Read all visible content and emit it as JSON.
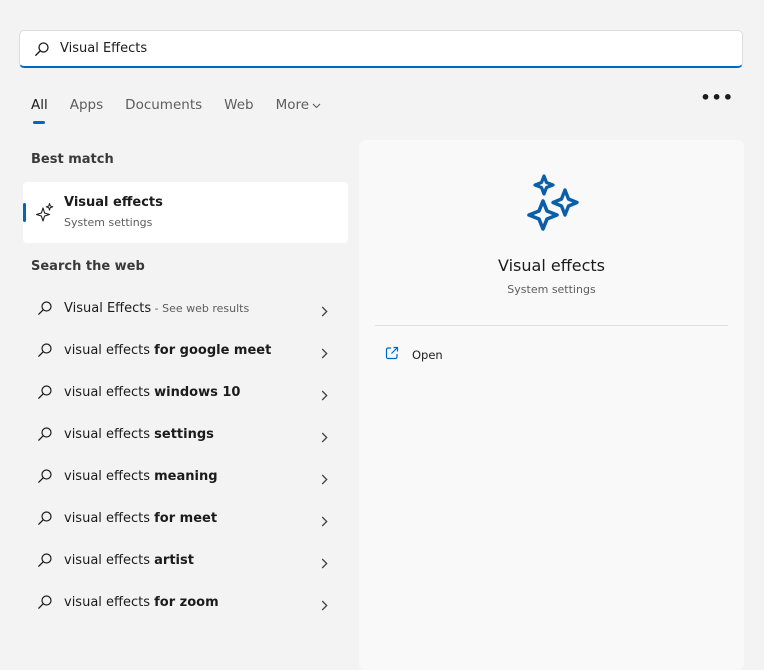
{
  "search": {
    "value": "Visual Effects",
    "icon": "search-icon"
  },
  "tabs": [
    {
      "label": "All",
      "active": true
    },
    {
      "label": "Apps"
    },
    {
      "label": "Documents"
    },
    {
      "label": "Web"
    },
    {
      "label": "More"
    }
  ],
  "more_options": "•••",
  "best_match": {
    "heading": "Best match",
    "title": "Visual effects",
    "subtitle": "System settings",
    "icon": "sparkle-icon"
  },
  "web": {
    "heading": "Search the web",
    "items": [
      {
        "prefix": "Visual Effects",
        "bold": "",
        "hint": " - See web results"
      },
      {
        "prefix": "visual effects ",
        "bold": "for google meet",
        "hint": ""
      },
      {
        "prefix": "visual effects ",
        "bold": "windows 10",
        "hint": ""
      },
      {
        "prefix": "visual effects ",
        "bold": "settings",
        "hint": ""
      },
      {
        "prefix": "visual effects ",
        "bold": "meaning",
        "hint": ""
      },
      {
        "prefix": "visual effects ",
        "bold": "for meet",
        "hint": ""
      },
      {
        "prefix": "visual effects ",
        "bold": "artist",
        "hint": ""
      },
      {
        "prefix": "visual effects ",
        "bold": "for zoom",
        "hint": ""
      }
    ]
  },
  "preview": {
    "title": "Visual effects",
    "subtitle": "System settings",
    "action_label": "Open"
  },
  "colors": {
    "accent": "#0067c0",
    "sparkle": "#0a5fa8"
  }
}
